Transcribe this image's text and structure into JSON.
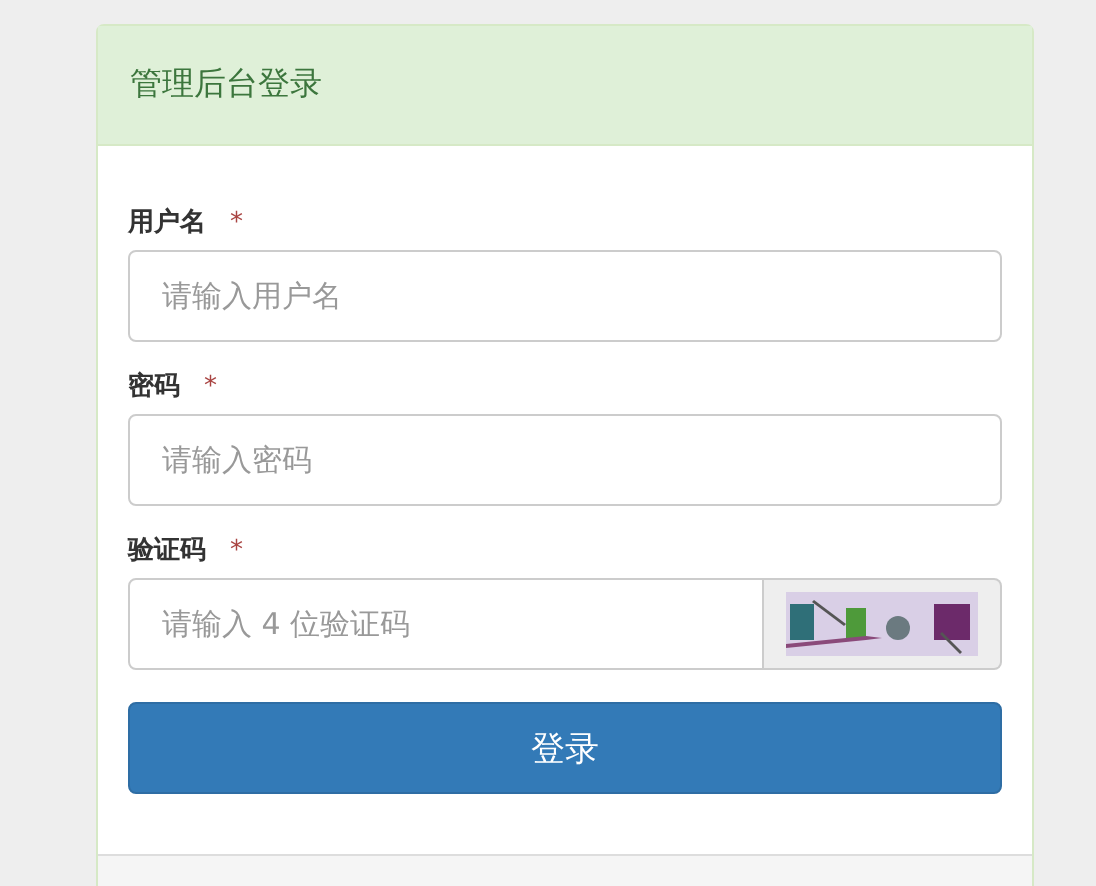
{
  "panel": {
    "title": "管理后台登录"
  },
  "fields": [
    {
      "label": "用户名",
      "required_mark": "*",
      "placeholder": "请输入用户名",
      "kind": "text"
    },
    {
      "label": "密码",
      "required_mark": "*",
      "placeholder": "请输入密码",
      "kind": "password"
    },
    {
      "label": "验证码",
      "required_mark": "*",
      "placeholder": "请输入 4 位验证码",
      "kind": "captcha"
    }
  ],
  "submit_button": "登录"
}
